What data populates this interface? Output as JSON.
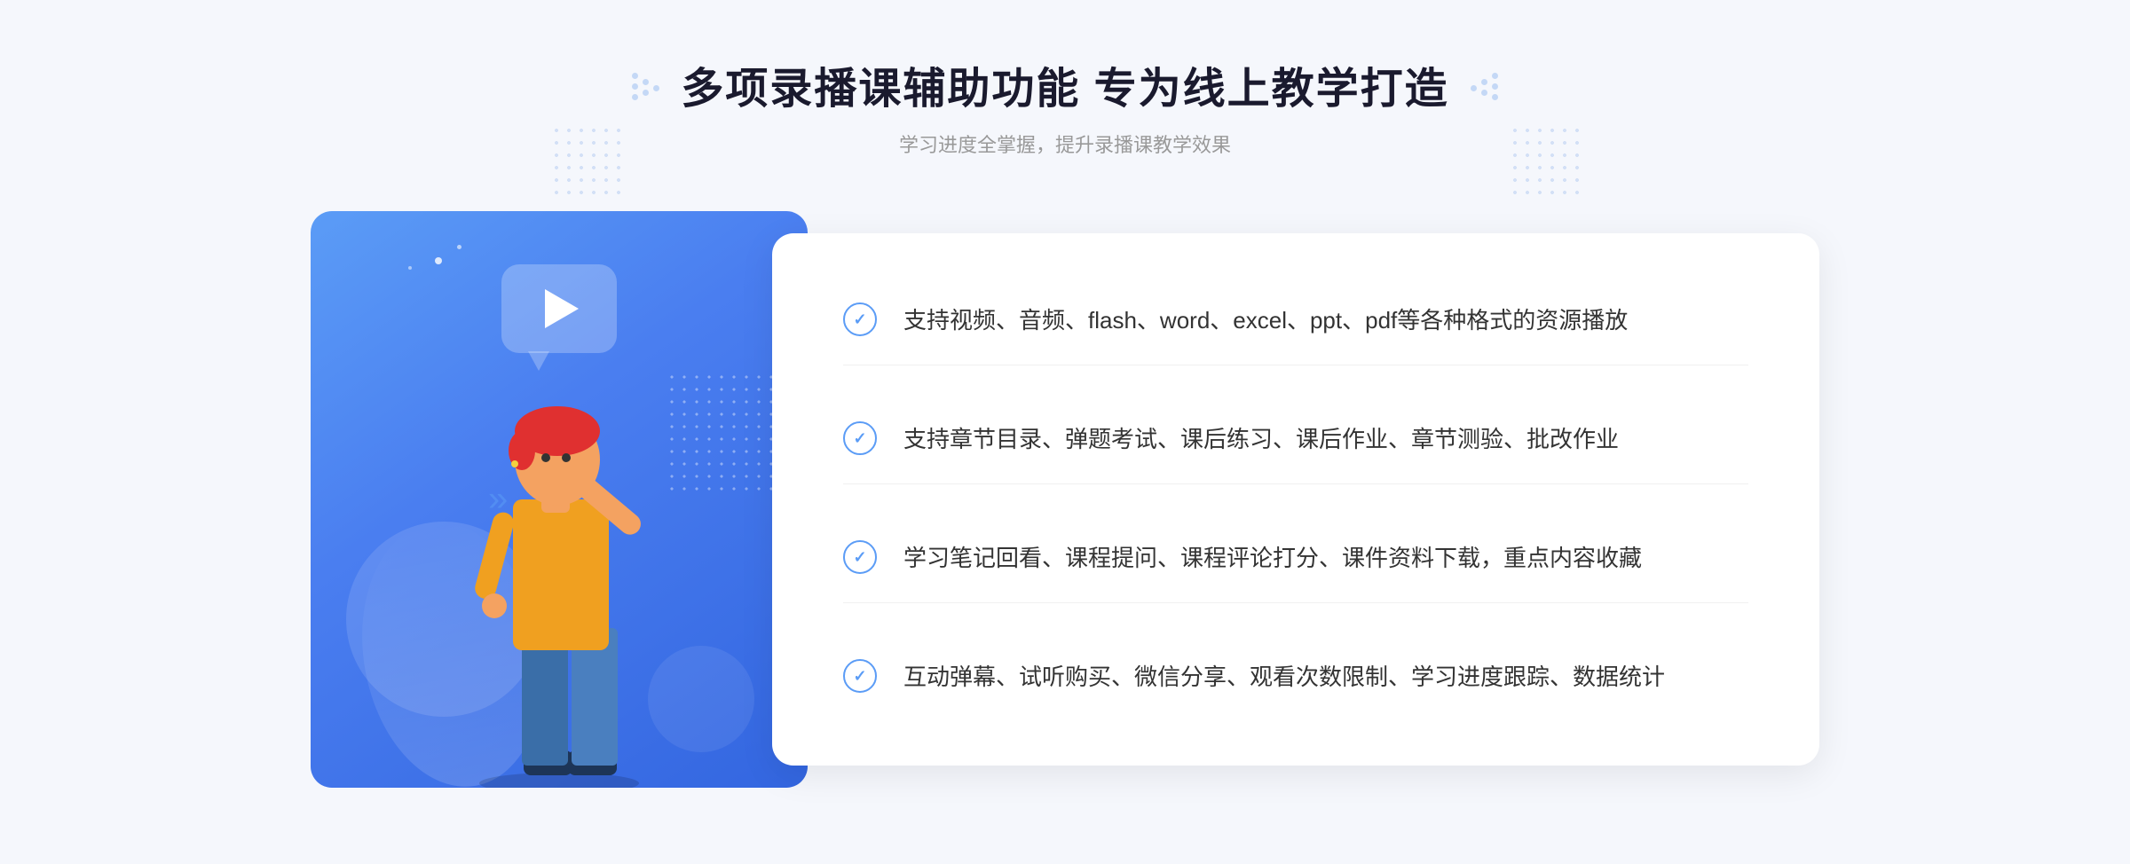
{
  "header": {
    "title": "多项录播课辅助功能 专为线上教学打造",
    "subtitle": "学习进度全掌握，提升录播课教学效果",
    "deco_left": "❈",
    "deco_right": "❈"
  },
  "features": [
    {
      "id": "feature-1",
      "text": "支持视频、音频、flash、word、excel、ppt、pdf等各种格式的资源播放"
    },
    {
      "id": "feature-2",
      "text": "支持章节目录、弹题考试、课后练习、课后作业、章节测验、批改作业"
    },
    {
      "id": "feature-3",
      "text": "学习笔记回看、课程提问、课程评论打分、课件资料下载，重点内容收藏"
    },
    {
      "id": "feature-4",
      "text": "互动弹幕、试听购买、微信分享、观看次数限制、学习进度跟踪、数据统计"
    }
  ],
  "colors": {
    "primary_blue": "#5b9cf6",
    "dark_blue": "#3366e0",
    "text_dark": "#1a1a2e",
    "text_gray": "#999999",
    "text_body": "#333333",
    "bg_light": "#f5f7fc",
    "white": "#ffffff"
  },
  "check_icon": "✓",
  "decoration": {
    "chevron": "»",
    "play_icon": "▶"
  }
}
